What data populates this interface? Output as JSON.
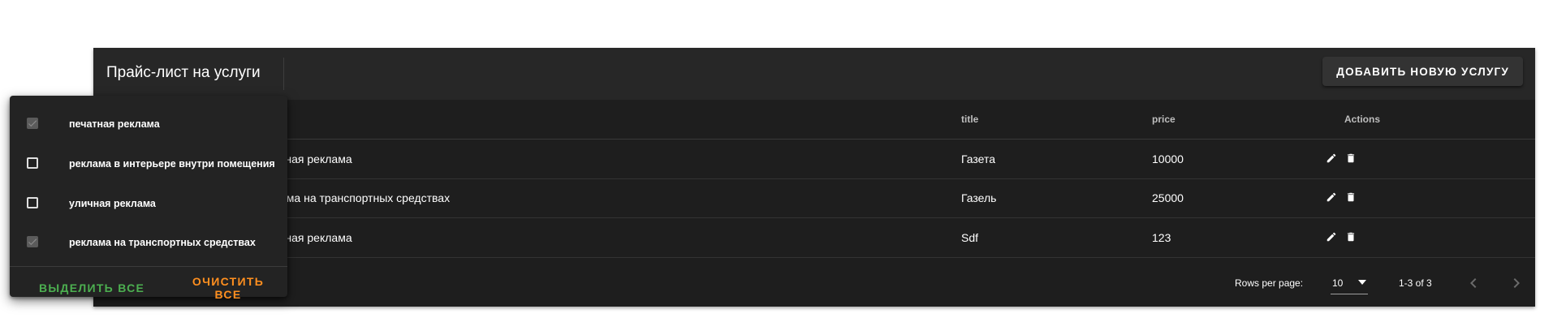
{
  "colors": {
    "select_all": "#4caf50",
    "clear_all": "#ff8f1f"
  },
  "toolbar": {
    "title": "Прайс-лист на услуги",
    "add_button": "ДОБАВИТЬ НОВУЮ УСЛУГУ"
  },
  "table": {
    "headers": {
      "title": "title",
      "price": "price",
      "actions": "Actions"
    },
    "rows": [
      {
        "category_visible": "тная реклама",
        "title": "Газета",
        "price": "10000",
        "icons": [
          "pencil-icon",
          "trash-icon"
        ]
      },
      {
        "category_visible": "ама на транспортных средствах",
        "title": "Газель",
        "price": "25000",
        "icons": [
          "pencil-icon",
          "trash-icon"
        ]
      },
      {
        "category_visible": "тная реклама",
        "title": "Sdf",
        "price": "123",
        "icons": [
          "pencil-icon",
          "trash-icon"
        ]
      }
    ]
  },
  "pagination": {
    "rows_per_page_label": "Rows per page:",
    "rows_per_page_value": "10",
    "range": "1-3 of 3",
    "prev_icon": "chevron-left-icon",
    "next_icon": "chevron-right-icon"
  },
  "filter_menu": {
    "options": [
      {
        "label": "печатная реклама",
        "checked": true
      },
      {
        "label": "реклама в интерьере внутри помещения",
        "checked": false
      },
      {
        "label": "уличная реклама",
        "checked": false
      },
      {
        "label": "реклама на транспортных средствах",
        "checked": true
      }
    ],
    "select_all": "ВЫДЕЛИТЬ ВСЕ",
    "clear_all": "ОЧИСТИТЬ ВСЕ"
  }
}
